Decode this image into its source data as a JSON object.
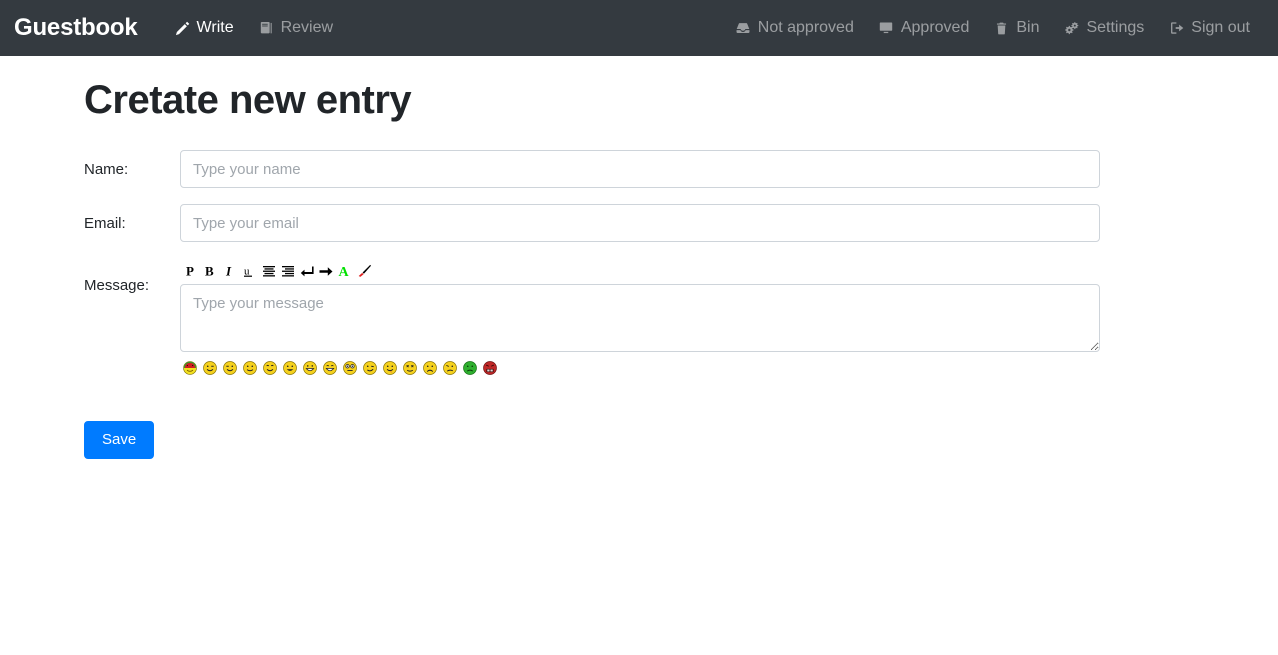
{
  "navbar": {
    "brand": "Guestbook",
    "background": "#343a40",
    "left_items": [
      {
        "label": "Write",
        "icon": "pencil-icon",
        "active": true
      },
      {
        "label": "Review",
        "icon": "book-icon",
        "active": false
      }
    ],
    "right_items": [
      {
        "label": "Not approved",
        "icon": "inbox-icon",
        "active": false
      },
      {
        "label": "Approved",
        "icon": "desktop-icon",
        "active": false
      },
      {
        "label": "Bin",
        "icon": "trash-icon",
        "active": false
      },
      {
        "label": "Settings",
        "icon": "cogs-icon",
        "active": false
      },
      {
        "label": "Sign out",
        "icon": "sign-out-icon",
        "active": false
      }
    ]
  },
  "page": {
    "title": "Cretate new entry"
  },
  "form": {
    "name": {
      "label": "Name:",
      "placeholder": "Type your name",
      "value": ""
    },
    "email": {
      "label": "Email:",
      "placeholder": "Type your email",
      "value": ""
    },
    "message": {
      "label": "Message:",
      "placeholder": "Type your message",
      "value": ""
    },
    "save_label": "Save",
    "save_color": "#007bff"
  },
  "editor_toolbar": {
    "buttons": [
      {
        "name": "paragraph-icon",
        "title": "Paragraph"
      },
      {
        "name": "bold-icon",
        "title": "Bold"
      },
      {
        "name": "italic-icon",
        "title": "Italic"
      },
      {
        "name": "underline-icon",
        "title": "Underline"
      },
      {
        "name": "align-center-icon",
        "title": "Center"
      },
      {
        "name": "align-right-icon",
        "title": "Right"
      },
      {
        "name": "line-break-icon",
        "title": "Line break"
      },
      {
        "name": "arrow-right-icon",
        "title": "Indent"
      },
      {
        "name": "font-color-icon",
        "title": "Font colour"
      },
      {
        "name": "paint-brush-icon",
        "title": "Highlight"
      }
    ]
  },
  "emoji_bar": {
    "emojis": [
      {
        "name": "emoji-watermelon-smiley"
      },
      {
        "name": "emoji-wink"
      },
      {
        "name": "emoji-wink-left"
      },
      {
        "name": "emoji-smile"
      },
      {
        "name": "emoji-happy"
      },
      {
        "name": "emoji-grin"
      },
      {
        "name": "emoji-laugh"
      },
      {
        "name": "emoji-big-laugh"
      },
      {
        "name": "emoji-goggle-eyes"
      },
      {
        "name": "emoji-smirk"
      },
      {
        "name": "emoji-tongue"
      },
      {
        "name": "emoji-dizzy"
      },
      {
        "name": "emoji-sad"
      },
      {
        "name": "emoji-confused"
      },
      {
        "name": "emoji-sick-green"
      },
      {
        "name": "emoji-angry-red"
      }
    ]
  }
}
